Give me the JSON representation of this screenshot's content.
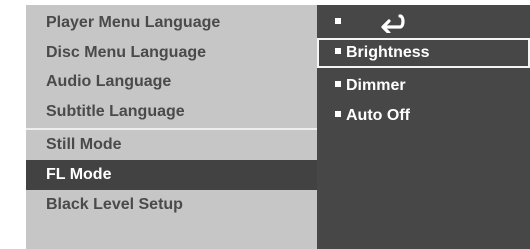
{
  "left_menu": {
    "items": [
      {
        "label": "Player Menu Language"
      },
      {
        "label": "Disc Menu Language"
      },
      {
        "label": "Audio Language"
      },
      {
        "label": "Subtitle Language"
      },
      {
        "label": "Still Mode"
      },
      {
        "label": "FL Mode"
      },
      {
        "label": "Black Level Setup"
      }
    ],
    "selected": "FL Mode"
  },
  "submenu": {
    "return_icon": "return-arrow-icon",
    "items": [
      {
        "label": "Brightness"
      },
      {
        "label": "Dimmer"
      },
      {
        "label": "Auto Off"
      }
    ],
    "highlighted": "Brightness"
  }
}
